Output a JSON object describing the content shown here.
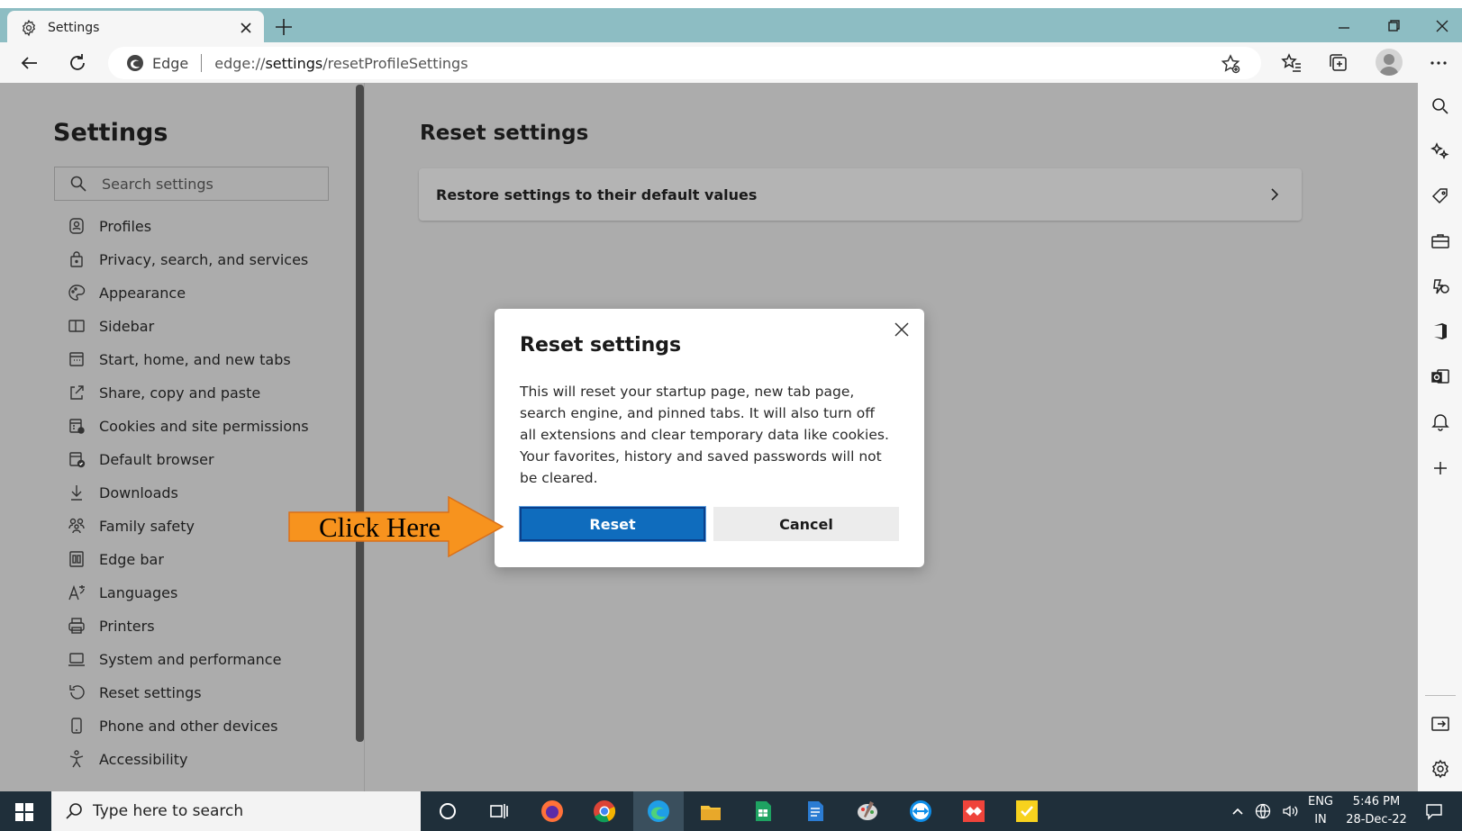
{
  "tab": {
    "title": "Settings"
  },
  "address": {
    "brand": "Edge",
    "url_prefix": "edge://",
    "url_host": "settings",
    "url_path": "/resetProfileSettings"
  },
  "sidebar": {
    "title": "Settings",
    "search_placeholder": "Search settings",
    "items": [
      {
        "label": "Profiles",
        "icon": "profile-icon"
      },
      {
        "label": "Privacy, search, and services",
        "icon": "lock-icon"
      },
      {
        "label": "Appearance",
        "icon": "palette-icon"
      },
      {
        "label": "Sidebar",
        "icon": "sidebar-icon"
      },
      {
        "label": "Start, home, and new tabs",
        "icon": "home-tabs-icon"
      },
      {
        "label": "Share, copy and paste",
        "icon": "share-icon"
      },
      {
        "label": "Cookies and site permissions",
        "icon": "cookies-icon"
      },
      {
        "label": "Default browser",
        "icon": "default-browser-icon"
      },
      {
        "label": "Downloads",
        "icon": "download-icon"
      },
      {
        "label": "Family safety",
        "icon": "family-icon"
      },
      {
        "label": "Edge bar",
        "icon": "edge-bar-icon"
      },
      {
        "label": "Languages",
        "icon": "languages-icon"
      },
      {
        "label": "Printers",
        "icon": "printer-icon"
      },
      {
        "label": "System and performance",
        "icon": "laptop-icon"
      },
      {
        "label": "Reset settings",
        "icon": "reset-icon"
      },
      {
        "label": "Phone and other devices",
        "icon": "phone-icon"
      },
      {
        "label": "Accessibility",
        "icon": "accessibility-icon"
      }
    ]
  },
  "content": {
    "title": "Reset settings",
    "card_label": "Restore settings to their default values"
  },
  "dialog": {
    "title": "Reset settings",
    "body": "This will reset your startup page, new tab page, search engine, and pinned tabs. It will also turn off all extensions and clear temporary data like cookies. Your favorites, history and saved passwords will not be cleared.",
    "reset_label": "Reset",
    "cancel_label": "Cancel"
  },
  "annotation": {
    "label": "Click Here",
    "color": "#f7931e"
  },
  "taskbar": {
    "search_placeholder": "Type here to search",
    "lang_top": "ENG",
    "lang_bottom": "IN",
    "time": "5:46 PM",
    "date": "28-Dec-22"
  },
  "colors": {
    "accent": "#0f6cbd",
    "titlebar": "#8dbdc3",
    "overlay": "#acacac"
  }
}
